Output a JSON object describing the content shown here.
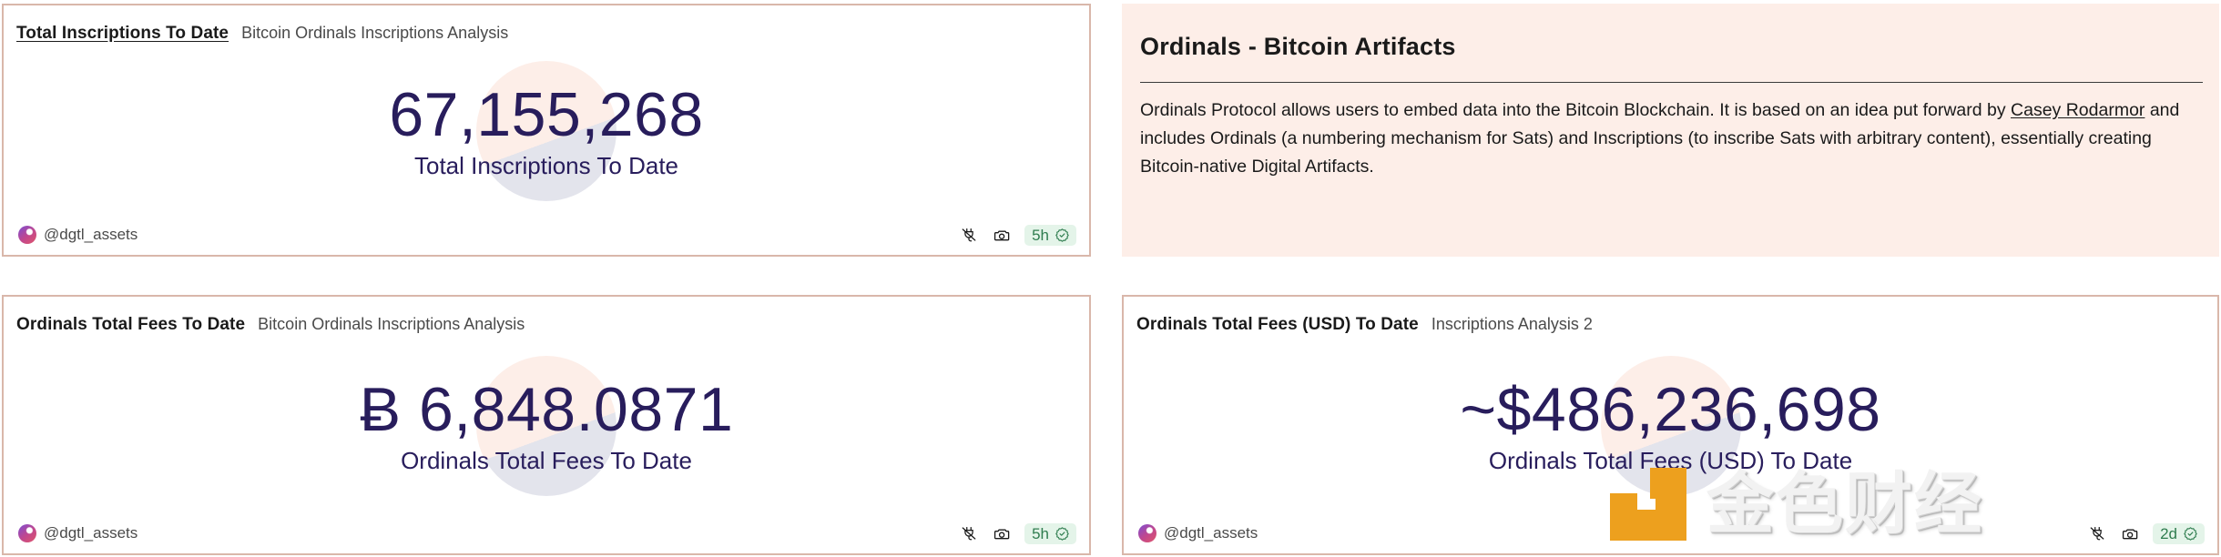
{
  "cards": [
    {
      "id": "total-inscriptions",
      "title": "Total Inscriptions To Date",
      "subtitle": "Bitcoin Ordinals Inscriptions Analysis",
      "value": "67,155,268",
      "label": "Total Inscriptions To Date",
      "author": "@dgtl_assets",
      "age": "5h"
    },
    {
      "id": "ordinals-total-fees",
      "title": "Ordinals Total Fees To Date",
      "subtitle": "Bitcoin Ordinals Inscriptions Analysis",
      "value": "Ƀ 6,848.0871",
      "label": "Ordinals Total Fees To Date",
      "author": "@dgtl_assets",
      "age": "5h"
    },
    {
      "id": "ordinals-total-fees-usd",
      "title": "Ordinals Total Fees (USD) To Date",
      "subtitle": "Inscriptions Analysis 2",
      "value": "~$486,236,698",
      "label": "Ordinals Total Fees (USD) To Date",
      "author": "@dgtl_assets",
      "age": "2d"
    }
  ],
  "info_panel": {
    "heading": "Ordinals - Bitcoin Artifacts",
    "paragraph_part_1": "Ordinals Protocol allows users to embed data into the Bitcoin Blockchain. It is based on an idea put forward by ",
    "link_text": "Casey Rodarmor",
    "paragraph_part_2": " and includes Ordinals (a numbering mechanism for Sats) and Inscriptions (to inscribe Sats with arbitrary content), essentially creating Bitcoin-native Digital Artifacts."
  },
  "watermark": {
    "text": "金色财经"
  },
  "colors": {
    "metric_text": "#281d5c",
    "card_border": "#d9b7aa",
    "info_panel_bg": "#fdeee8",
    "badge_bg": "#e4f4e9",
    "badge_text": "#2f7d4f",
    "watermark_accent": "#eda01e",
    "deco_peach": "#fdeee8",
    "deco_gray": "#e3e4ec"
  }
}
